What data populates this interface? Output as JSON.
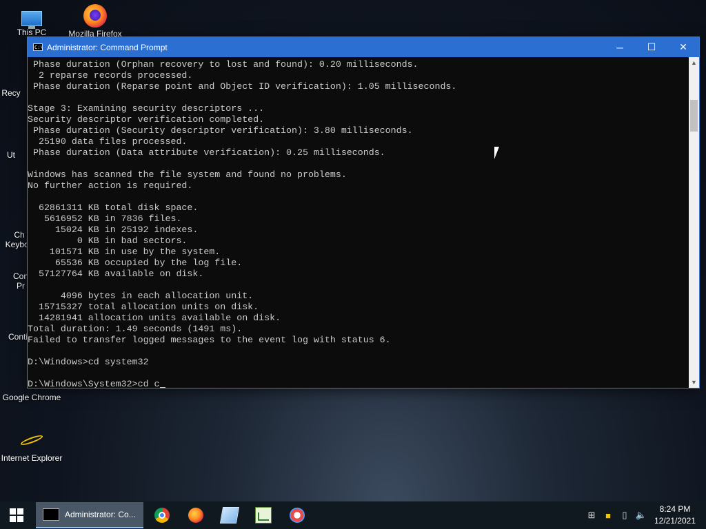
{
  "desktop": {
    "icons": [
      {
        "label": "This PC"
      },
      {
        "label": "Mozilla Firefox"
      },
      {
        "label": "Recy"
      },
      {
        "label": "Ut"
      },
      {
        "label": "Ch\nKeyboa"
      },
      {
        "label": "Con\nPr"
      },
      {
        "label": "Conti"
      },
      {
        "label": "Google Chrome"
      },
      {
        "label": "Internet Explorer"
      }
    ]
  },
  "window": {
    "title": "Administrator: Command Prompt",
    "icon_text": "C:\\",
    "controls": {
      "minimize": "─",
      "maximize": "☐",
      "close": "✕"
    },
    "console_lines": [
      " Phase duration (Orphan recovery to lost and found): 0.20 milliseconds.",
      "  2 reparse records processed.",
      " Phase duration (Reparse point and Object ID verification): 1.05 milliseconds.",
      "",
      "Stage 3: Examining security descriptors ...",
      "Security descriptor verification completed.",
      " Phase duration (Security descriptor verification): 3.80 milliseconds.",
      "  25190 data files processed.",
      " Phase duration (Data attribute verification): 0.25 milliseconds.",
      "",
      "Windows has scanned the file system and found no problems.",
      "No further action is required.",
      "",
      "  62861311 KB total disk space.",
      "   5616952 KB in 7836 files.",
      "     15024 KB in 25192 indexes.",
      "         0 KB in bad sectors.",
      "    101571 KB in use by the system.",
      "     65536 KB occupied by the log file.",
      "  57127764 KB available on disk.",
      "",
      "      4096 bytes in each allocation unit.",
      "  15715327 total allocation units on disk.",
      "  14281941 allocation units available on disk.",
      "Total duration: 1.49 seconds (1491 ms).",
      "Failed to transfer logged messages to the event log with status 6.",
      "",
      "D:\\Windows>cd system32",
      ""
    ],
    "prompt_line": "D:\\Windows\\System32>cd c",
    "scrollbar": {
      "up": "▲",
      "down": "▼"
    }
  },
  "taskbar": {
    "active_task": "Administrator: Co...",
    "pinned": [
      "chrome-icon",
      "firefox-icon",
      "notepad-icon",
      "chart-app-icon",
      "paint-app-icon"
    ],
    "tray": {
      "network": "⊞",
      "flag": "■",
      "usb": "▯",
      "volume": "🔈"
    },
    "time": "8:24 PM",
    "date": "12/21/2021"
  }
}
